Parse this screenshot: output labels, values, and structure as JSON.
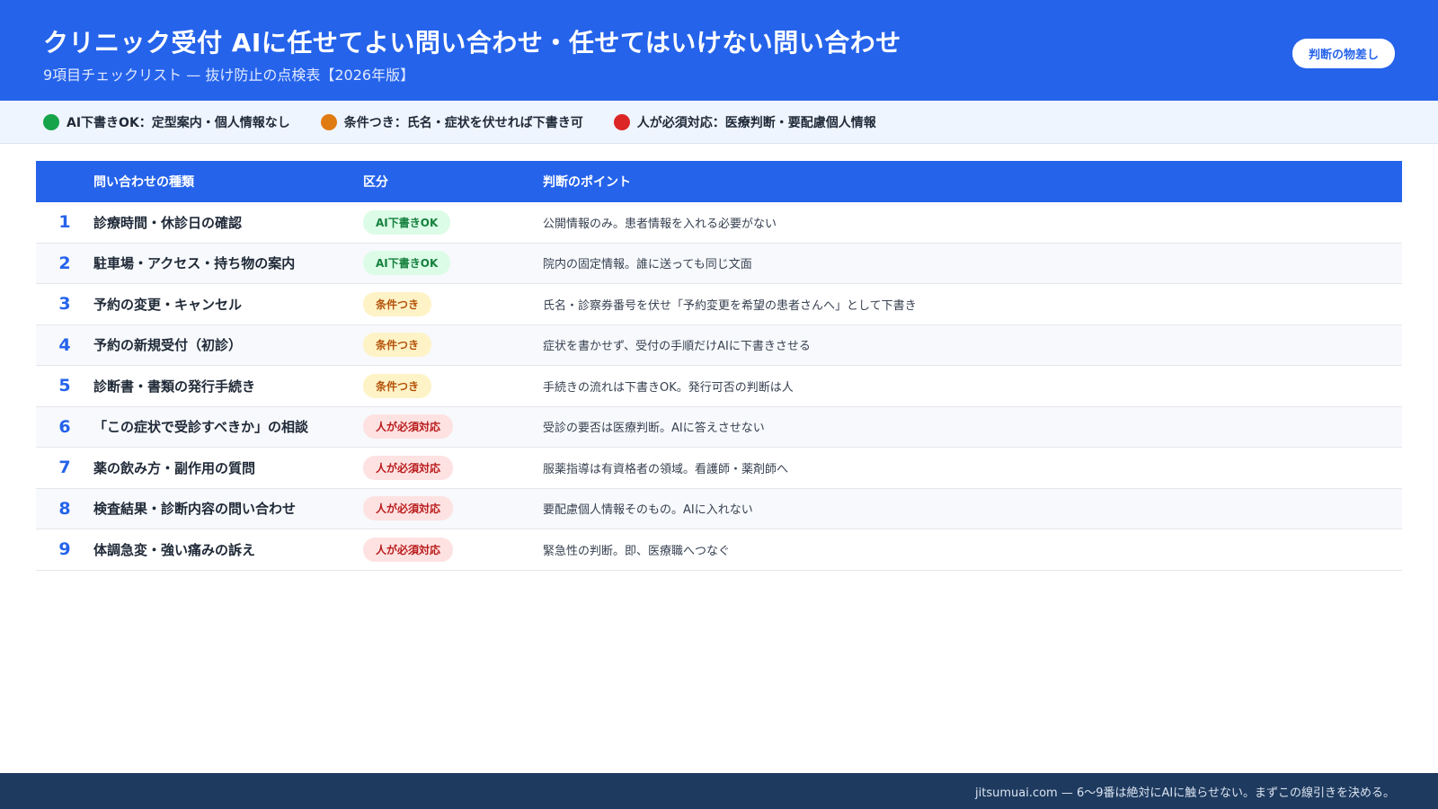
{
  "header": {
    "title": "クリニック受付 AIに任せてよい問い合わせ・任せてはいけない問い合わせ",
    "subtitle": "9項目チェックリスト — 抜け防止の点検表【2026年版】",
    "pill_label": "判断の物差し"
  },
  "legend": {
    "items": [
      {
        "label": "AI下書きOK：定型案内・個人情報なし",
        "color": "#16a34a"
      },
      {
        "label": "条件つき：氏名・症状を伏せれば下書き可",
        "color": "#f59e0b"
      },
      {
        "label": "人が必須対応：医療判断・要配慮個人情報",
        "color": "#dc2626"
      }
    ]
  },
  "table": {
    "headers": {
      "number": "",
      "type": "問い合わせの種類",
      "category": "区分",
      "note": "判断のポイント"
    },
    "rows": [
      {
        "number": "1",
        "type": "診療時間・休診日の確認",
        "category": "AI下書きOK",
        "category_kind": "ok",
        "note": "公開情報のみ。患者情報を入れる必要がない"
      },
      {
        "number": "2",
        "type": "駐車場・アクセス・持ち物の案内",
        "category": "AI下書きOK",
        "category_kind": "ok",
        "note": "院内の固定情報。誰に送っても同じ文面"
      },
      {
        "number": "3",
        "type": "予約の変更・キャンセル",
        "category": "条件つき",
        "category_kind": "cond",
        "note": "氏名・診察券番号を伏せ「予約変更を希望の患者さんへ」として下書き"
      },
      {
        "number": "4",
        "type": "予約の新規受付（初診）",
        "category": "条件つき",
        "category_kind": "cond",
        "note": "症状を書かせず、受付の手順だけAIに下書きさせる"
      },
      {
        "number": "5",
        "type": "診断書・書類の発行手続き",
        "category": "条件つき",
        "category_kind": "cond",
        "note": "手続きの流れは下書きOK。発行可否の判断は人"
      },
      {
        "number": "6",
        "type": "「この症状で受診すべきか」の相談",
        "category": "人が必須対応",
        "category_kind": "human",
        "note": "受診の要否は医療判断。AIに答えさせない"
      },
      {
        "number": "7",
        "type": "薬の飲み方・副作用の質問",
        "category": "人が必須対応",
        "category_kind": "human",
        "note": "服薬指導は有資格者の領域。看護師・薬剤師へ"
      },
      {
        "number": "8",
        "type": "検査結果・診断内容の問い合わせ",
        "category": "人が必須対応",
        "category_kind": "human",
        "note": "要配慮個人情報そのもの。AIに入れない"
      },
      {
        "number": "9",
        "type": "体調急変・強い痛みの訴え",
        "category": "人が必須対応",
        "category_kind": "human",
        "note": "緊急性の判断。即、医療職へつなぐ"
      }
    ]
  },
  "footer": {
    "text": "jitsumuai.com — 6〜9番は絶対にAIに触らせない。まずこの線引きを決める。"
  }
}
